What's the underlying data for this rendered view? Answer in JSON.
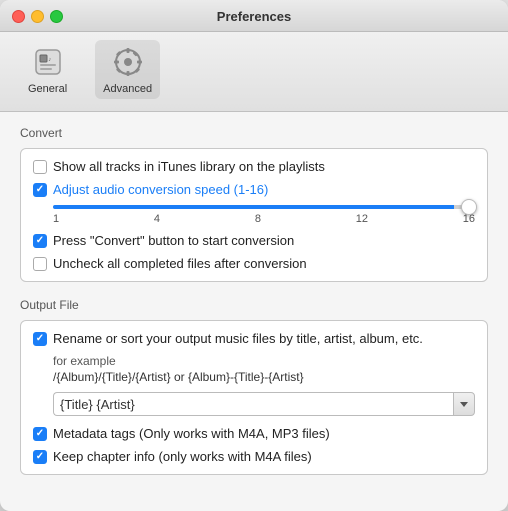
{
  "window": {
    "title": "Preferences"
  },
  "toolbar": {
    "items": [
      {
        "id": "general",
        "label": "General",
        "icon": "general-icon"
      },
      {
        "id": "advanced",
        "label": "Advanced",
        "icon": "advanced-icon",
        "active": true
      }
    ]
  },
  "convert_section": {
    "title": "Convert",
    "checkboxes": [
      {
        "id": "show-all-tracks",
        "label": "Show all tracks in iTunes library on the playlists",
        "checked": false
      },
      {
        "id": "adjust-audio",
        "label": "Adjust audio conversion speed (1-16)",
        "checked": true
      },
      {
        "id": "press-convert",
        "label": "Press \"Convert\" button to start conversion",
        "checked": true
      },
      {
        "id": "uncheck-completed",
        "label": "Uncheck all completed files after conversion",
        "checked": false
      }
    ],
    "slider": {
      "min": 1,
      "max": 16,
      "value": 16,
      "labels": [
        "1",
        "4",
        "8",
        "12",
        "16"
      ]
    }
  },
  "output_section": {
    "title": "Output File",
    "rename_checkbox": {
      "id": "rename-sort",
      "label": "Rename or sort your output music files by title, artist, album, etc.",
      "checked": true
    },
    "example_label": "for example",
    "example_format": "/{Album}/{Title}/{Artist} or {Album}-{Title}-{Artist}",
    "input_value": "{Title} {Artist}",
    "metadata_checkbox": {
      "id": "metadata-tags",
      "label": "Metadata tags (Only works with M4A, MP3 files)",
      "checked": true
    },
    "chapter_checkbox": {
      "id": "keep-chapter",
      "label": "Keep chapter info (only works with  M4A files)",
      "checked": true
    }
  }
}
